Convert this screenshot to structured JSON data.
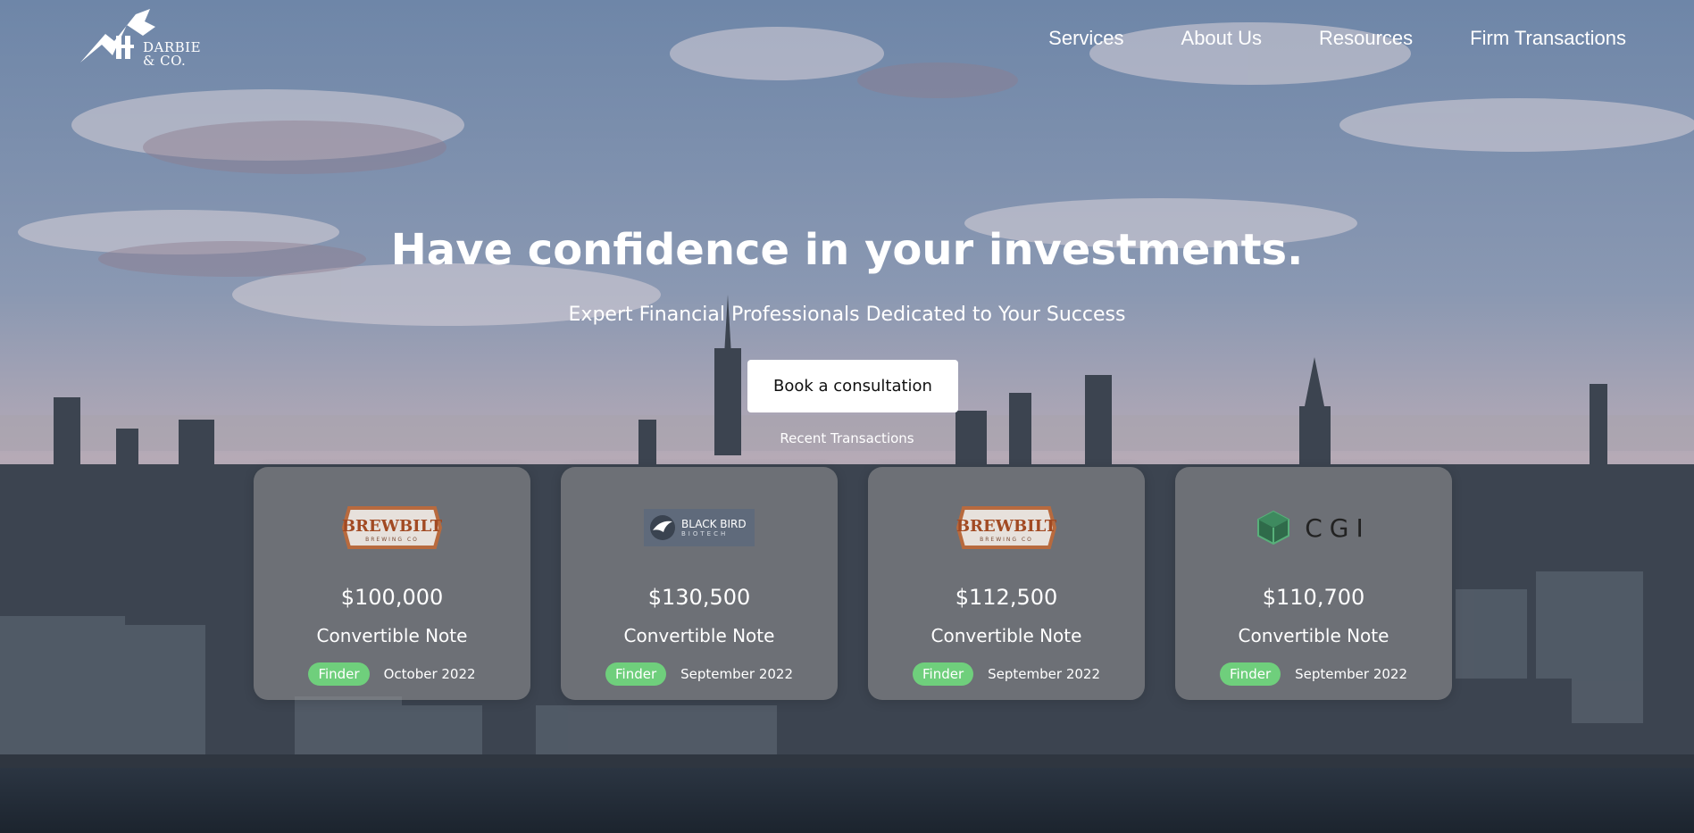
{
  "brand": {
    "name_line1": "DARBIE",
    "name_line2": "& CO."
  },
  "nav": [
    {
      "label": "Services"
    },
    {
      "label": "About Us"
    },
    {
      "label": "Resources"
    },
    {
      "label": "Firm Transactions"
    }
  ],
  "hero": {
    "title": "Have confidence in your investments.",
    "subtitle": "Expert Financial Professionals Dedicated to Your Success",
    "cta_label": "Book a consultation",
    "recent_label": "Recent Transactions"
  },
  "cards": [
    {
      "logo": "brewbilt-logo",
      "logo_text": "BREWBILT",
      "logo_subtext": "BREWING CO",
      "amount": "$100,000",
      "type": "Convertible Note",
      "badge": "Finder",
      "date": "October 2022"
    },
    {
      "logo": "blackbird-logo",
      "logo_text": "BLACK BIRD",
      "logo_subtext": "BIOTECH",
      "amount": "$130,500",
      "type": "Convertible Note",
      "badge": "Finder",
      "date": "September 2022"
    },
    {
      "logo": "brewbilt-logo",
      "logo_text": "BREWBILT",
      "logo_subtext": "BREWING CO",
      "amount": "$112,500",
      "type": "Convertible Note",
      "badge": "Finder",
      "date": "September 2022"
    },
    {
      "logo": "cgi-logo",
      "logo_text": "CGI",
      "amount": "$110,700",
      "type": "Convertible Note",
      "badge": "Finder",
      "date": "September 2022"
    }
  ],
  "colors": {
    "badge": "#6fcf7c",
    "cta_bg": "#ffffff",
    "card_bg": "rgba(150,150,150,0.55)"
  }
}
